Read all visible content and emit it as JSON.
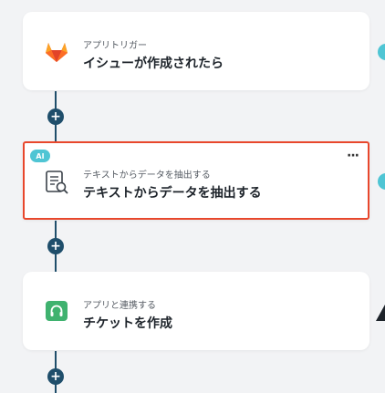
{
  "add_step_symbol": "+",
  "steps": [
    {
      "small_label": "アプリトリガー",
      "title": "イシューが作成されたら",
      "icon": "gitlab-icon"
    },
    {
      "badge": "AI",
      "small_label": "テキストからデータを抽出する",
      "title": "テキストからデータを抽出する",
      "icon": "document-search-icon",
      "more_label": "···"
    },
    {
      "small_label": "アプリと連携する",
      "title": "チケットを作成",
      "icon": "headset-icon"
    }
  ],
  "colors": {
    "connector": "#1f4e6b",
    "selection_border": "#e8472c",
    "ai_badge": "#4fc5d4",
    "gitlab_orange": "#e24329",
    "headset_green": "#3fb26f"
  }
}
